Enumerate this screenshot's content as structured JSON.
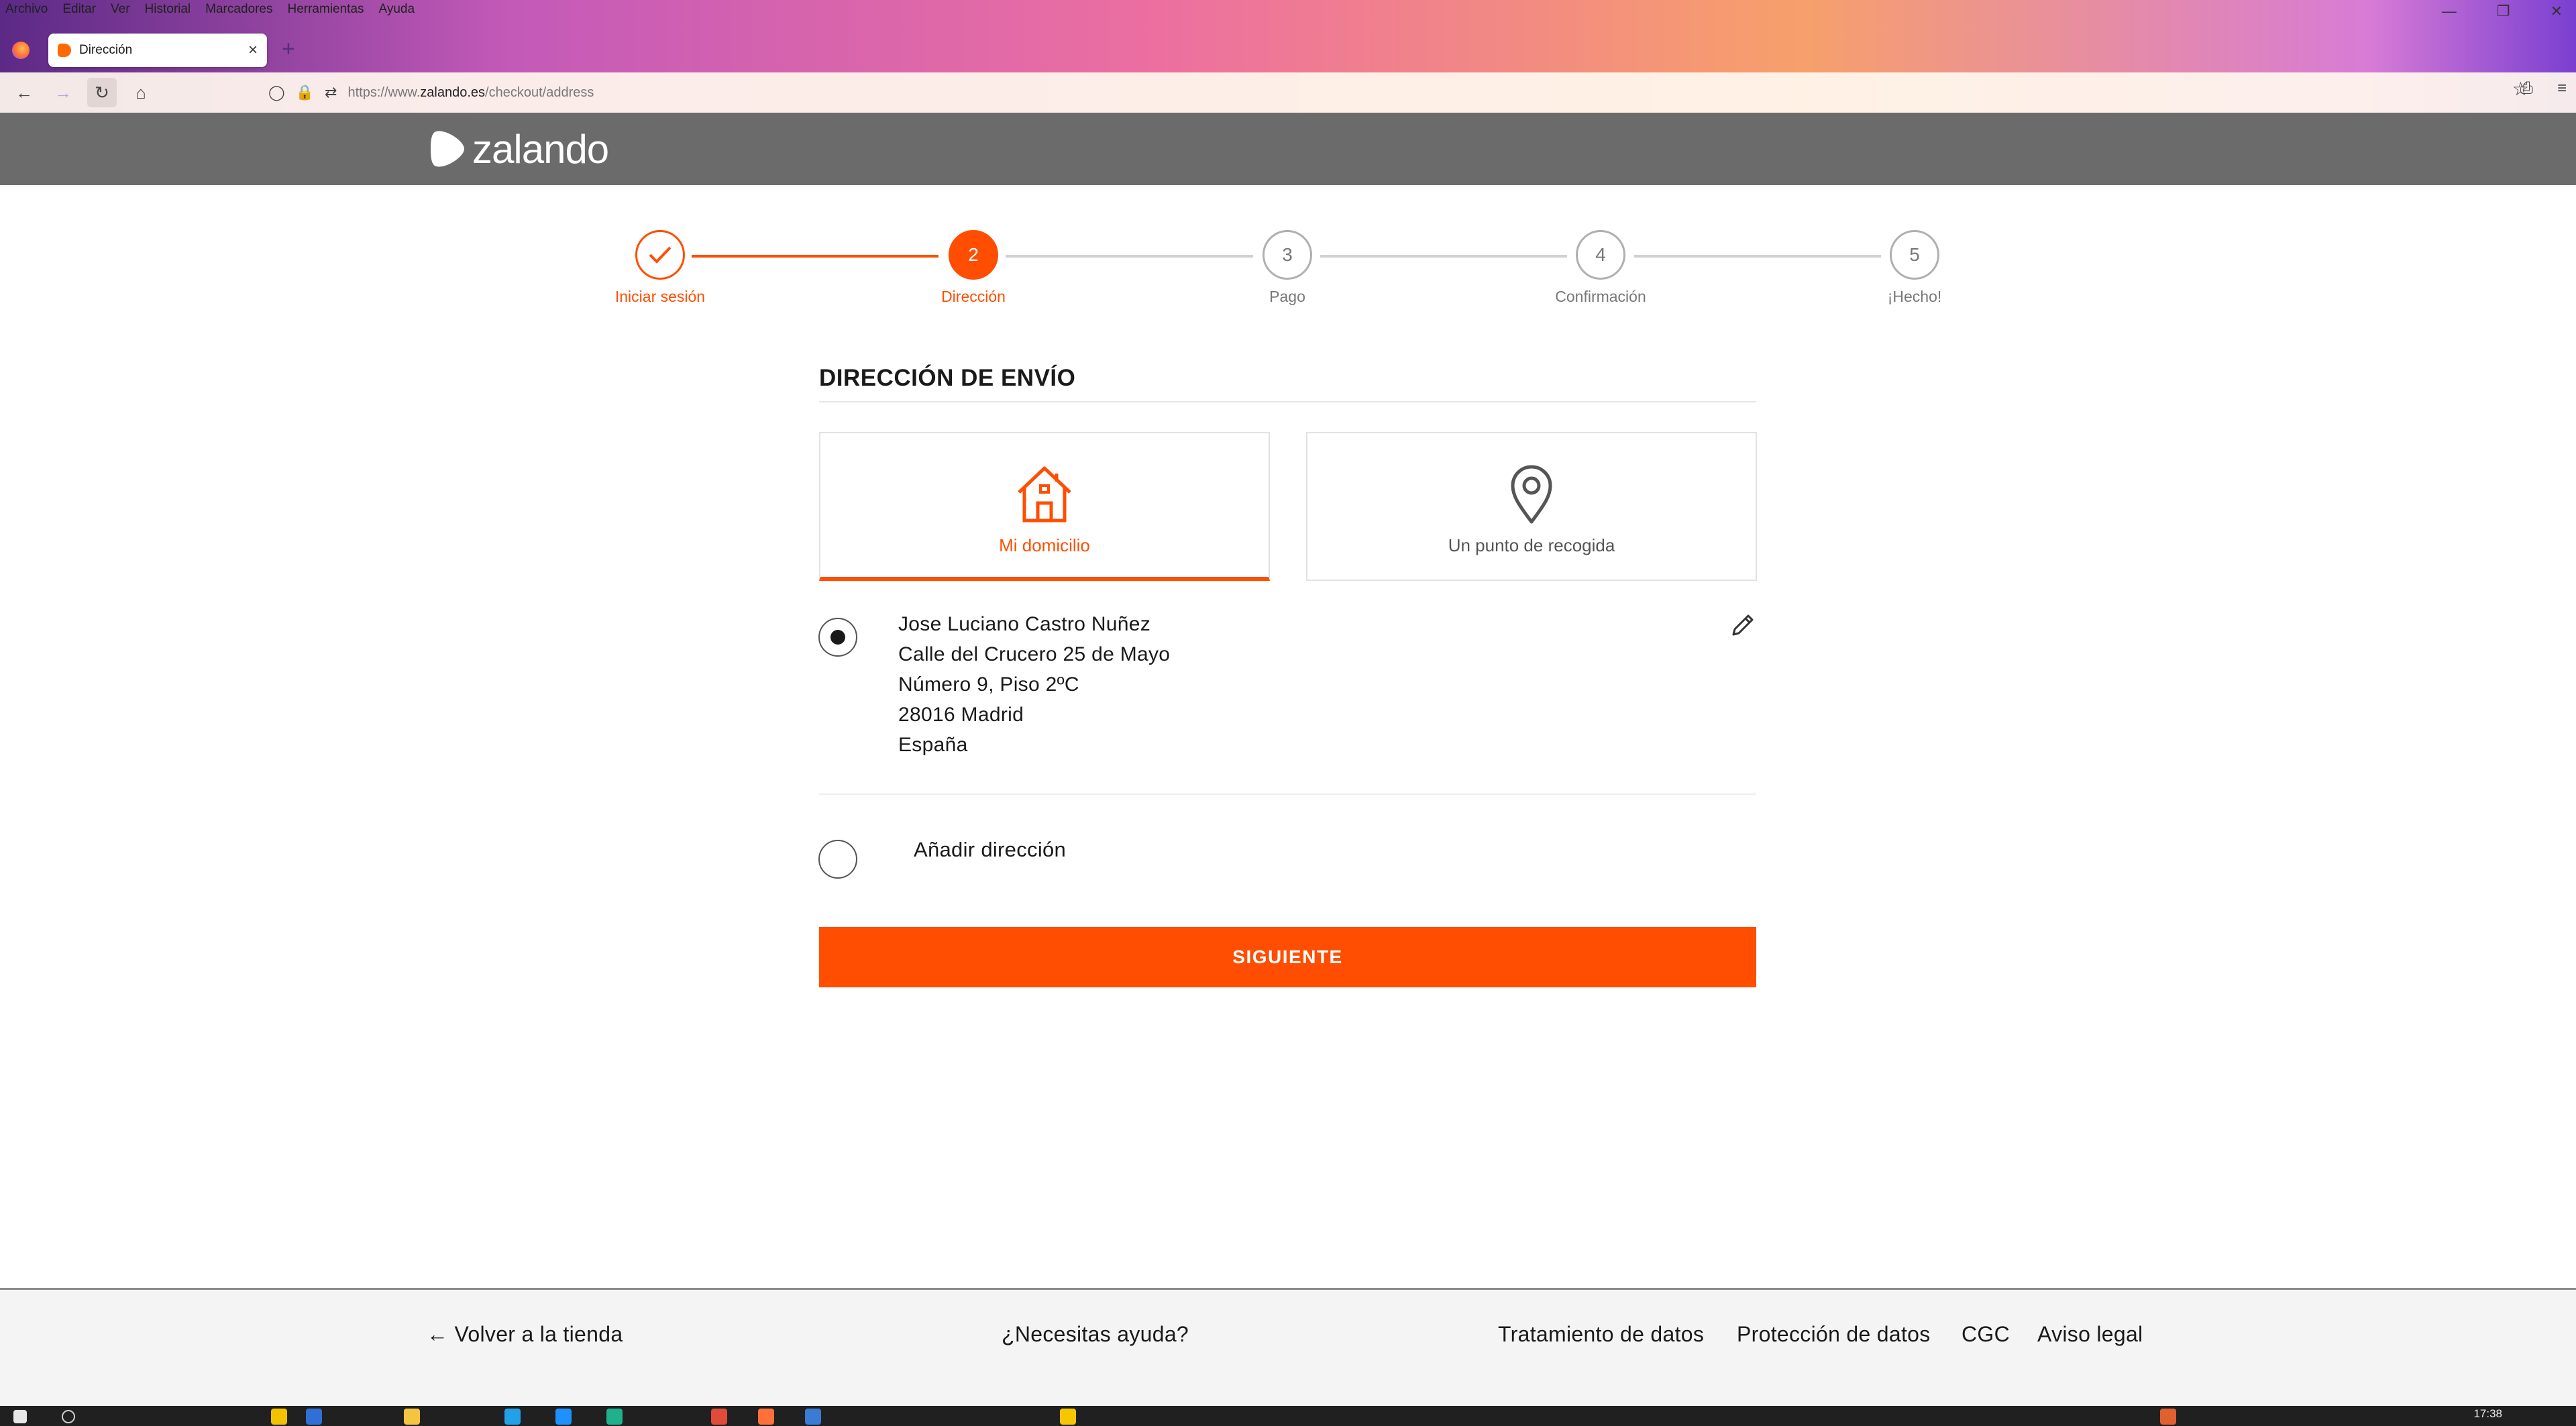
{
  "browser": {
    "menu": [
      "Archivo",
      "Editar",
      "Ver",
      "Historial",
      "Marcadores",
      "Herramientas",
      "Ayuda"
    ],
    "tab_title": "Dirección",
    "url_prefix": "https://www.",
    "url_domain": "zalando.es",
    "url_path": "/checkout/address"
  },
  "site": {
    "logo_text": "zalando",
    "brand_color": "#ff4e02"
  },
  "stepper": {
    "steps": [
      {
        "number": "1",
        "label": "Iniciar sesión",
        "state": "done"
      },
      {
        "number": "2",
        "label": "Dirección",
        "state": "active"
      },
      {
        "number": "3",
        "label": "Pago",
        "state": "todo"
      },
      {
        "number": "4",
        "label": "Confirmación",
        "state": "todo"
      },
      {
        "number": "5",
        "label": "¡Hecho!",
        "state": "todo"
      }
    ]
  },
  "shipping": {
    "title": "DIRECCIÓN DE ENVÍO",
    "options": [
      {
        "label": "Mi domicilio",
        "icon": "house-icon",
        "selected": true
      },
      {
        "label": "Un punto de recogida",
        "icon": "location-pin-icon",
        "selected": false
      }
    ],
    "address": {
      "name": "Jose Luciano Castro Nuñez",
      "line1": "Calle del Crucero 25 de Mayo",
      "line2": "Número 9, Piso 2ºC",
      "city": "28016 Madrid",
      "country": "España"
    },
    "add_address_label": "Añadir dirección",
    "next_button": "SIGUIENTE"
  },
  "footer": {
    "back_to_shop": "Volver a la tienda",
    "help": "¿Necesitas ayuda?",
    "data_processing": "Tratamiento de datos",
    "data_protection": "Protección de datos",
    "terms": "CGC",
    "legal": "Aviso legal"
  },
  "taskbar": {
    "time": "17:38"
  }
}
